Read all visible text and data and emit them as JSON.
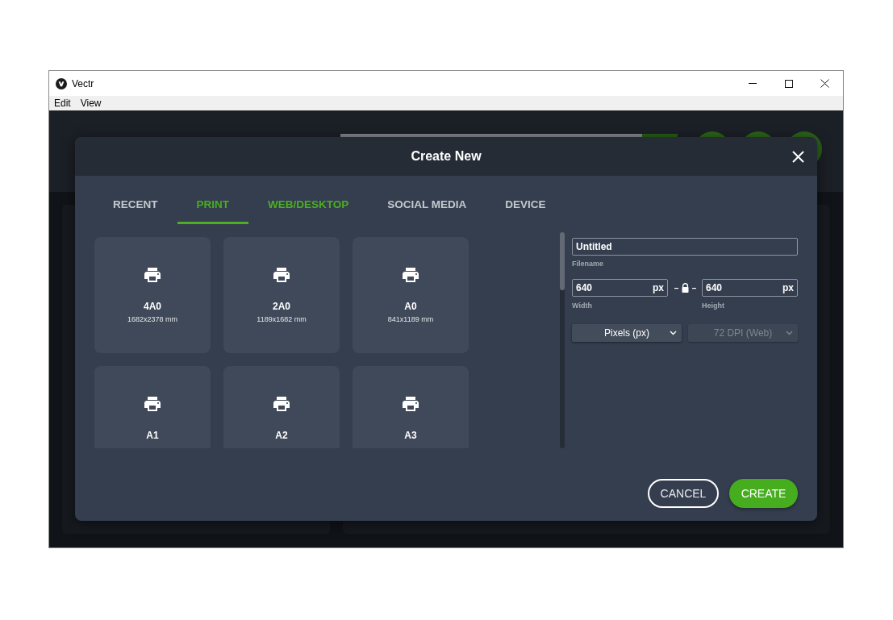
{
  "window": {
    "title": "Vectr"
  },
  "menu": [
    {
      "label": "Edit"
    },
    {
      "label": "View"
    }
  ],
  "dialog": {
    "title": "Create New",
    "tabs": [
      {
        "label": "RECENT",
        "selected": false,
        "highlighted": false
      },
      {
        "label": "PRINT",
        "selected": true,
        "highlighted": false
      },
      {
        "label": "WEB/DESKTOP",
        "selected": false,
        "highlighted": true
      },
      {
        "label": "SOCIAL MEDIA",
        "selected": false,
        "highlighted": false
      },
      {
        "label": "DEVICE",
        "selected": false,
        "highlighted": false
      }
    ],
    "presets": [
      {
        "name": "4A0",
        "size": "1682x2378 mm"
      },
      {
        "name": "2A0",
        "size": "1189x1682 mm"
      },
      {
        "name": "A0",
        "size": "841x1189 mm"
      },
      {
        "name": "A1"
      },
      {
        "name": "A2"
      },
      {
        "name": "A3"
      }
    ],
    "filename": {
      "value": "Untitled",
      "label": "Filename"
    },
    "width": {
      "value": "640",
      "unit": "px",
      "label": "Width"
    },
    "height": {
      "value": "640",
      "unit": "px",
      "label": "Height"
    },
    "unit_select": {
      "value": "Pixels (px)",
      "disabled": false
    },
    "dpi_select": {
      "value": "72 DPI (Web)",
      "disabled": true
    },
    "buttons": [
      {
        "label": "CANCEL",
        "kind": "outline"
      },
      {
        "label": "CREATE",
        "kind": "primary"
      }
    ]
  }
}
